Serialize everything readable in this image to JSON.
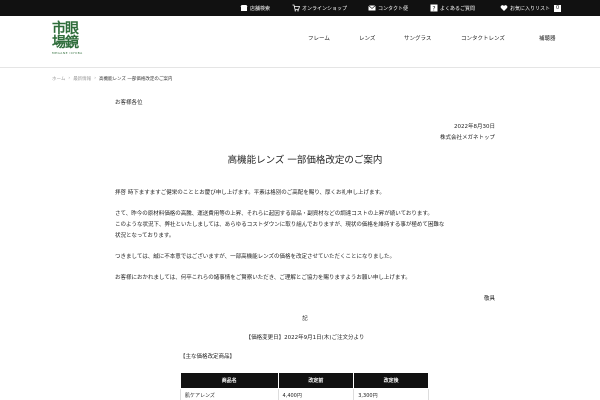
{
  "topbar": {
    "items": [
      {
        "label": "店舗検索",
        "icon": "store-icon"
      },
      {
        "label": "オンラインショップ",
        "icon": "cart-icon"
      },
      {
        "label": "コンタクト便",
        "icon": "mail-icon"
      },
      {
        "label": "よくあるご質問",
        "icon": "question-icon"
      },
      {
        "label": "お気に入りリスト",
        "icon": "heart-icon"
      }
    ],
    "count": "0"
  },
  "logo": {
    "main": "市眼\n場鏡",
    "sub": "MEGANE ICHIBA"
  },
  "nav": {
    "items": [
      "フレーム",
      "レンズ",
      "サングラス",
      "コンタクトレンズ",
      "補聴器"
    ]
  },
  "breadcrumb": {
    "home": "ホーム",
    "parent": "最新情報",
    "current": "高機能レンズ 一部価格改定のご案内"
  },
  "letter": {
    "salutation": "お客様各位",
    "date": "2022年8月30日",
    "company": "株式会社メガネトップ",
    "title": "高機能レンズ 一部価格改定のご案内",
    "para1": "拝啓 時下ますますご健栄のこととお慶び申し上げます。平素は格別のご高配を賜り、厚くお礼申し上げます。",
    "para2_l1": "さて、昨今の原材料価格の高騰、運送費用等の上昇、それらに起因する部品・副資材などの調達コストの上昇が続いております。",
    "para2_l2": "このような状況下、弊社といたしましては、あらゆるコストダウンに取り組んでおりますが、現状の価格を維持する事が極めて困難な",
    "para2_l3": "状況となっております。",
    "para3": "つきましては、誠に不本意ではございますが、一部高機能レンズの価格を改定させていただくことになりました。",
    "para4": "お客様におかれましては、何卒これらの諸事情をご賢察いただき、ご理解とご協力を賜りますようお願い申し上げます。",
    "closing": "敬具",
    "ki": "記",
    "effective": "【価格変更日】2022年9月1日(木)ご注文分より",
    "list_title": "【主な価格改定商品】"
  },
  "table": {
    "headers": [
      "商品名",
      "改定前",
      "改定後"
    ],
    "rows": [
      {
        "name": "肌ケアレンズ",
        "before": "4,400円",
        "after": "3,300円"
      }
    ]
  },
  "colors": {
    "brand": "#2f6d3b",
    "topbar": "#111111"
  }
}
